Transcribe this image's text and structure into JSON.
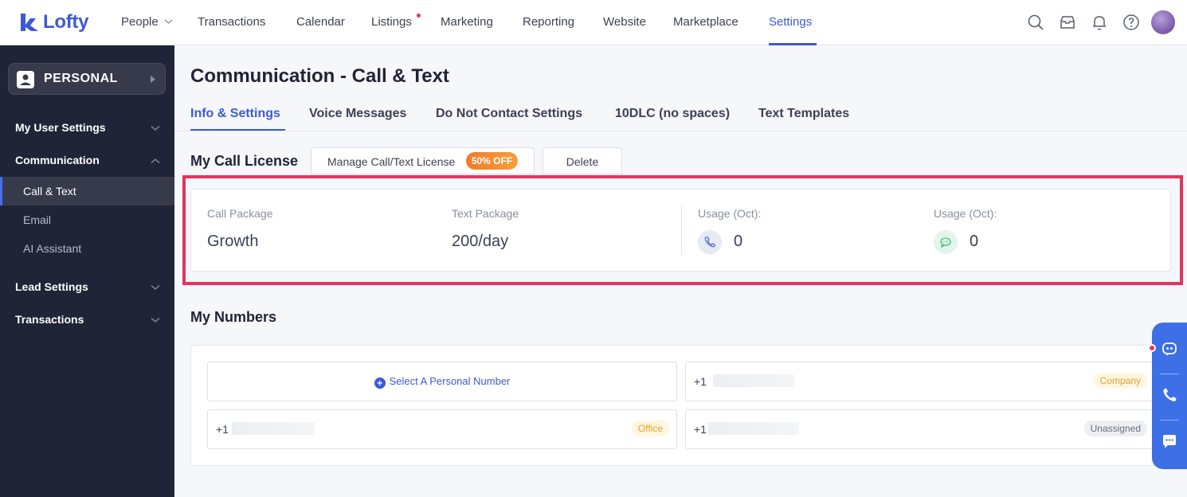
{
  "app": {
    "logo_text": "Lofty",
    "brand_color": "#3d59d6"
  },
  "nav": {
    "items": [
      {
        "label": "People",
        "has_dropdown": true
      },
      {
        "label": "Transactions"
      },
      {
        "label": "Calendar"
      },
      {
        "label": "Listings",
        "has_notification_dot": true
      },
      {
        "label": "Marketing"
      },
      {
        "label": "Reporting"
      },
      {
        "label": "Website"
      },
      {
        "label": "Marketplace"
      },
      {
        "label": "Settings",
        "active": true
      }
    ],
    "icons": [
      "search-icon",
      "inbox-icon",
      "bell-icon",
      "help-icon",
      "avatar"
    ]
  },
  "sidebar": {
    "workspace_label": "PERSONAL",
    "groups": [
      {
        "label": "My User Settings",
        "expanded": false
      },
      {
        "label": "Communication",
        "expanded": true,
        "items": [
          {
            "label": "Call & Text",
            "active": true
          },
          {
            "label": "Email"
          },
          {
            "label": "AI Assistant"
          }
        ]
      },
      {
        "label": "Lead Settings",
        "expanded": false
      },
      {
        "label": "Transactions",
        "expanded": false
      }
    ]
  },
  "main": {
    "title": "Communication - Call & Text",
    "tabs": [
      {
        "label": "Info & Settings",
        "active": true
      },
      {
        "label": "Voice Messages"
      },
      {
        "label": "Do Not Contact Settings"
      },
      {
        "label": "10DLC (no spaces)"
      },
      {
        "label": "Text Templates"
      }
    ],
    "license": {
      "title": "My Call License",
      "manage_button": "Manage Call/Text License",
      "discount_badge": "50% OFF",
      "delete_button": "Delete",
      "call_package_label": "Call Package",
      "call_package_value": "Growth",
      "text_package_label": "Text Package",
      "text_package_value": "200/day",
      "call_usage_label": "Usage (Oct):",
      "call_usage_value": "0",
      "text_usage_label": "Usage (Oct):",
      "text_usage_value": "0"
    },
    "numbers": {
      "title": "My Numbers",
      "select_label": "Select A Personal Number",
      "entries": [
        {
          "prefix": "+1",
          "tag": "Company"
        },
        {
          "prefix": "+1",
          "tag": "Office"
        },
        {
          "prefix": "+1",
          "tag": "Unassigned"
        }
      ]
    }
  },
  "dock": {
    "icons": [
      "chat-bot-icon",
      "phone-icon",
      "message-icon"
    ],
    "color": "#3d6fe6"
  }
}
